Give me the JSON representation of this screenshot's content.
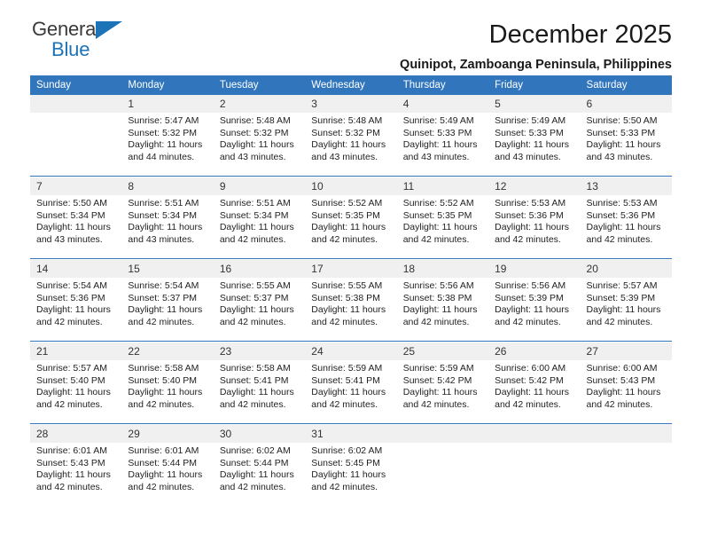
{
  "brand": {
    "name_part1": "General",
    "name_part2": "Blue",
    "accent_color": "#1c73b8",
    "triangle_icon": "triangle-icon"
  },
  "header": {
    "title": "December 2025",
    "subtitle": "Quinipot, Zamboanga Peninsula, Philippines"
  },
  "calendar": {
    "header_bg": "#3176bc",
    "daynum_bg": "#f0f0f0",
    "weekday_names": [
      "Sunday",
      "Monday",
      "Tuesday",
      "Wednesday",
      "Thursday",
      "Friday",
      "Saturday"
    ],
    "weeks": [
      [
        {
          "day": "",
          "lines": []
        },
        {
          "day": "1",
          "lines": [
            "Sunrise: 5:47 AM",
            "Sunset: 5:32 PM",
            "Daylight: 11 hours",
            "and 44 minutes."
          ]
        },
        {
          "day": "2",
          "lines": [
            "Sunrise: 5:48 AM",
            "Sunset: 5:32 PM",
            "Daylight: 11 hours",
            "and 43 minutes."
          ]
        },
        {
          "day": "3",
          "lines": [
            "Sunrise: 5:48 AM",
            "Sunset: 5:32 PM",
            "Daylight: 11 hours",
            "and 43 minutes."
          ]
        },
        {
          "day": "4",
          "lines": [
            "Sunrise: 5:49 AM",
            "Sunset: 5:33 PM",
            "Daylight: 11 hours",
            "and 43 minutes."
          ]
        },
        {
          "day": "5",
          "lines": [
            "Sunrise: 5:49 AM",
            "Sunset: 5:33 PM",
            "Daylight: 11 hours",
            "and 43 minutes."
          ]
        },
        {
          "day": "6",
          "lines": [
            "Sunrise: 5:50 AM",
            "Sunset: 5:33 PM",
            "Daylight: 11 hours",
            "and 43 minutes."
          ]
        }
      ],
      [
        {
          "day": "7",
          "lines": [
            "Sunrise: 5:50 AM",
            "Sunset: 5:34 PM",
            "Daylight: 11 hours",
            "and 43 minutes."
          ]
        },
        {
          "day": "8",
          "lines": [
            "Sunrise: 5:51 AM",
            "Sunset: 5:34 PM",
            "Daylight: 11 hours",
            "and 43 minutes."
          ]
        },
        {
          "day": "9",
          "lines": [
            "Sunrise: 5:51 AM",
            "Sunset: 5:34 PM",
            "Daylight: 11 hours",
            "and 42 minutes."
          ]
        },
        {
          "day": "10",
          "lines": [
            "Sunrise: 5:52 AM",
            "Sunset: 5:35 PM",
            "Daylight: 11 hours",
            "and 42 minutes."
          ]
        },
        {
          "day": "11",
          "lines": [
            "Sunrise: 5:52 AM",
            "Sunset: 5:35 PM",
            "Daylight: 11 hours",
            "and 42 minutes."
          ]
        },
        {
          "day": "12",
          "lines": [
            "Sunrise: 5:53 AM",
            "Sunset: 5:36 PM",
            "Daylight: 11 hours",
            "and 42 minutes."
          ]
        },
        {
          "day": "13",
          "lines": [
            "Sunrise: 5:53 AM",
            "Sunset: 5:36 PM",
            "Daylight: 11 hours",
            "and 42 minutes."
          ]
        }
      ],
      [
        {
          "day": "14",
          "lines": [
            "Sunrise: 5:54 AM",
            "Sunset: 5:36 PM",
            "Daylight: 11 hours",
            "and 42 minutes."
          ]
        },
        {
          "day": "15",
          "lines": [
            "Sunrise: 5:54 AM",
            "Sunset: 5:37 PM",
            "Daylight: 11 hours",
            "and 42 minutes."
          ]
        },
        {
          "day": "16",
          "lines": [
            "Sunrise: 5:55 AM",
            "Sunset: 5:37 PM",
            "Daylight: 11 hours",
            "and 42 minutes."
          ]
        },
        {
          "day": "17",
          "lines": [
            "Sunrise: 5:55 AM",
            "Sunset: 5:38 PM",
            "Daylight: 11 hours",
            "and 42 minutes."
          ]
        },
        {
          "day": "18",
          "lines": [
            "Sunrise: 5:56 AM",
            "Sunset: 5:38 PM",
            "Daylight: 11 hours",
            "and 42 minutes."
          ]
        },
        {
          "day": "19",
          "lines": [
            "Sunrise: 5:56 AM",
            "Sunset: 5:39 PM",
            "Daylight: 11 hours",
            "and 42 minutes."
          ]
        },
        {
          "day": "20",
          "lines": [
            "Sunrise: 5:57 AM",
            "Sunset: 5:39 PM",
            "Daylight: 11 hours",
            "and 42 minutes."
          ]
        }
      ],
      [
        {
          "day": "21",
          "lines": [
            "Sunrise: 5:57 AM",
            "Sunset: 5:40 PM",
            "Daylight: 11 hours",
            "and 42 minutes."
          ]
        },
        {
          "day": "22",
          "lines": [
            "Sunrise: 5:58 AM",
            "Sunset: 5:40 PM",
            "Daylight: 11 hours",
            "and 42 minutes."
          ]
        },
        {
          "day": "23",
          "lines": [
            "Sunrise: 5:58 AM",
            "Sunset: 5:41 PM",
            "Daylight: 11 hours",
            "and 42 minutes."
          ]
        },
        {
          "day": "24",
          "lines": [
            "Sunrise: 5:59 AM",
            "Sunset: 5:41 PM",
            "Daylight: 11 hours",
            "and 42 minutes."
          ]
        },
        {
          "day": "25",
          "lines": [
            "Sunrise: 5:59 AM",
            "Sunset: 5:42 PM",
            "Daylight: 11 hours",
            "and 42 minutes."
          ]
        },
        {
          "day": "26",
          "lines": [
            "Sunrise: 6:00 AM",
            "Sunset: 5:42 PM",
            "Daylight: 11 hours",
            "and 42 minutes."
          ]
        },
        {
          "day": "27",
          "lines": [
            "Sunrise: 6:00 AM",
            "Sunset: 5:43 PM",
            "Daylight: 11 hours",
            "and 42 minutes."
          ]
        }
      ],
      [
        {
          "day": "28",
          "lines": [
            "Sunrise: 6:01 AM",
            "Sunset: 5:43 PM",
            "Daylight: 11 hours",
            "and 42 minutes."
          ]
        },
        {
          "day": "29",
          "lines": [
            "Sunrise: 6:01 AM",
            "Sunset: 5:44 PM",
            "Daylight: 11 hours",
            "and 42 minutes."
          ]
        },
        {
          "day": "30",
          "lines": [
            "Sunrise: 6:02 AM",
            "Sunset: 5:44 PM",
            "Daylight: 11 hours",
            "and 42 minutes."
          ]
        },
        {
          "day": "31",
          "lines": [
            "Sunrise: 6:02 AM",
            "Sunset: 5:45 PM",
            "Daylight: 11 hours",
            "and 42 minutes."
          ]
        },
        {
          "day": "",
          "lines": []
        },
        {
          "day": "",
          "lines": []
        },
        {
          "day": "",
          "lines": []
        }
      ]
    ]
  }
}
